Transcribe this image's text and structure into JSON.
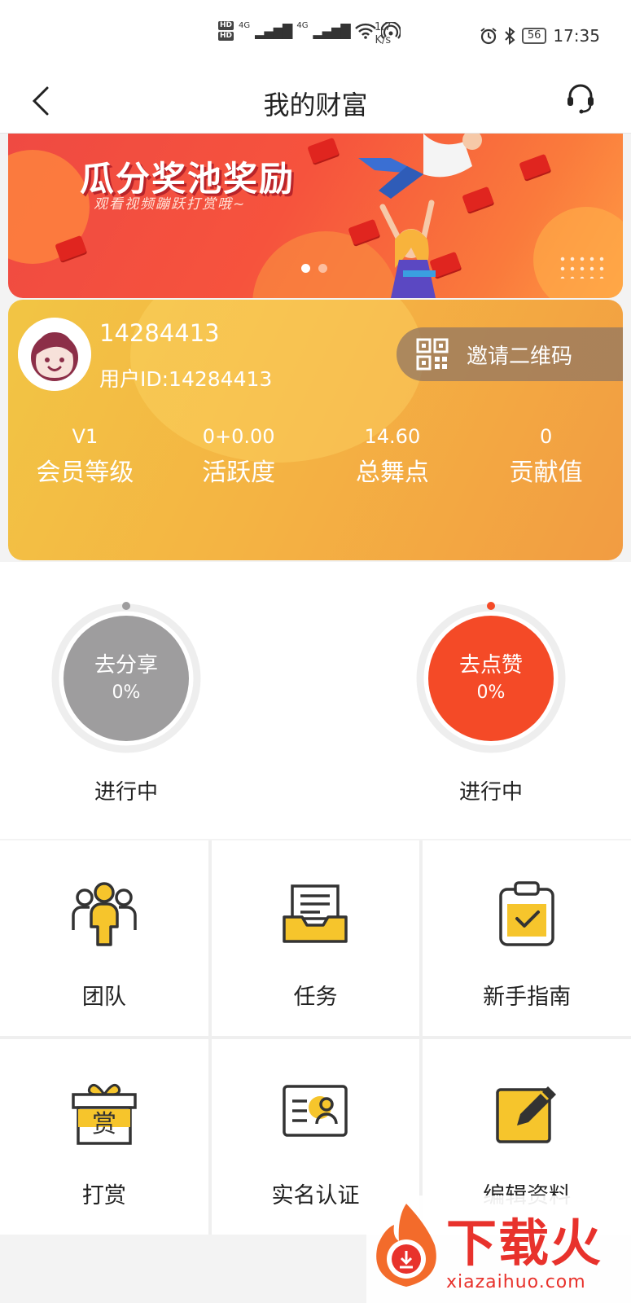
{
  "status_bar": {
    "hd1": "HD",
    "hd2": "HD",
    "net1": "4G",
    "net2": "4G",
    "speed_value": "1.7",
    "speed_unit": "K/s",
    "battery": "56",
    "time": "17:35"
  },
  "nav": {
    "title": "我的财富"
  },
  "banner": {
    "title": "瓜分奖池奖励",
    "subtitle": "观看视频蹦跃打赏哦~",
    "slide_count": 2,
    "active_slide": 1
  },
  "profile": {
    "username": "14284413",
    "user_id": "用户ID:14284413",
    "invite_label": "邀请二维码",
    "stats": [
      {
        "value": "V1",
        "label": "会员等级"
      },
      {
        "value": "0+0.00",
        "label": "活跃度"
      },
      {
        "value": "14.60",
        "label": "总舞点"
      },
      {
        "value": "0",
        "label": "贡献值"
      }
    ]
  },
  "progress": {
    "share": {
      "title": "去分享",
      "percent": "0%",
      "status": "进行中",
      "fraction": 0,
      "color": "#9e9d9e"
    },
    "like": {
      "title": "去点赞",
      "percent": "0%",
      "status": "进行中",
      "fraction": 0,
      "color": "#f44a27"
    }
  },
  "grid": [
    {
      "label": "团队",
      "icon": "team-icon"
    },
    {
      "label": "任务",
      "icon": "task-icon"
    },
    {
      "label": "新手指南",
      "icon": "guide-icon"
    },
    {
      "label": "打赏",
      "icon": "reward-gift-icon",
      "icon_text": "赏"
    },
    {
      "label": "实名认证",
      "icon": "id-card-icon"
    },
    {
      "label": "编辑资料",
      "icon": "edit-icon"
    }
  ],
  "watermark": {
    "text": "下载火",
    "url": "xiazaihuo.com"
  },
  "colors": {
    "accent_yellow": "#f6c52c",
    "card_gradient_start": "#f2c544",
    "card_gradient_end": "#f29c42",
    "banner_red": "#ef4a42",
    "share_gray": "#9e9d9e",
    "like_red": "#f44a27"
  }
}
